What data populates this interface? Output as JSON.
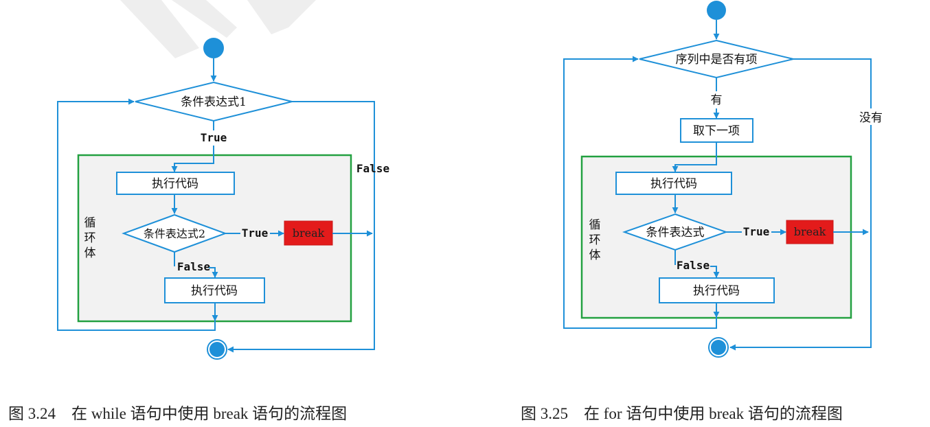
{
  "fig1": {
    "cond1": "条件表达式1",
    "true_label": "True",
    "false_label": "False",
    "exec_top": "执行代码",
    "cond2": "条件表达式2",
    "inner_true": "True",
    "break_label": "break",
    "inner_false": "False",
    "exec_bottom": "执行代码",
    "loop_body": [
      "循",
      "环",
      "体"
    ],
    "caption": "图 3.24　在 while 语句中使用 break 语句的流程图"
  },
  "fig2": {
    "seq_cond": "序列中是否有项",
    "has_label": "有",
    "none_label": "没有",
    "take_next": "取下一项",
    "exec_top": "执行代码",
    "cond": "条件表达式",
    "inner_true": "True",
    "break_label": "break",
    "inner_false": "False",
    "exec_bottom": "执行代码",
    "loop_body": [
      "循",
      "环",
      "体"
    ],
    "caption": "图 3.25　在 for 语句中使用 break 语句的流程图"
  },
  "colors": {
    "line": "#1e90d8",
    "loop_border": "#22a040",
    "loop_fill": "#f2f2f2",
    "break_fill": "#e31b1b"
  }
}
